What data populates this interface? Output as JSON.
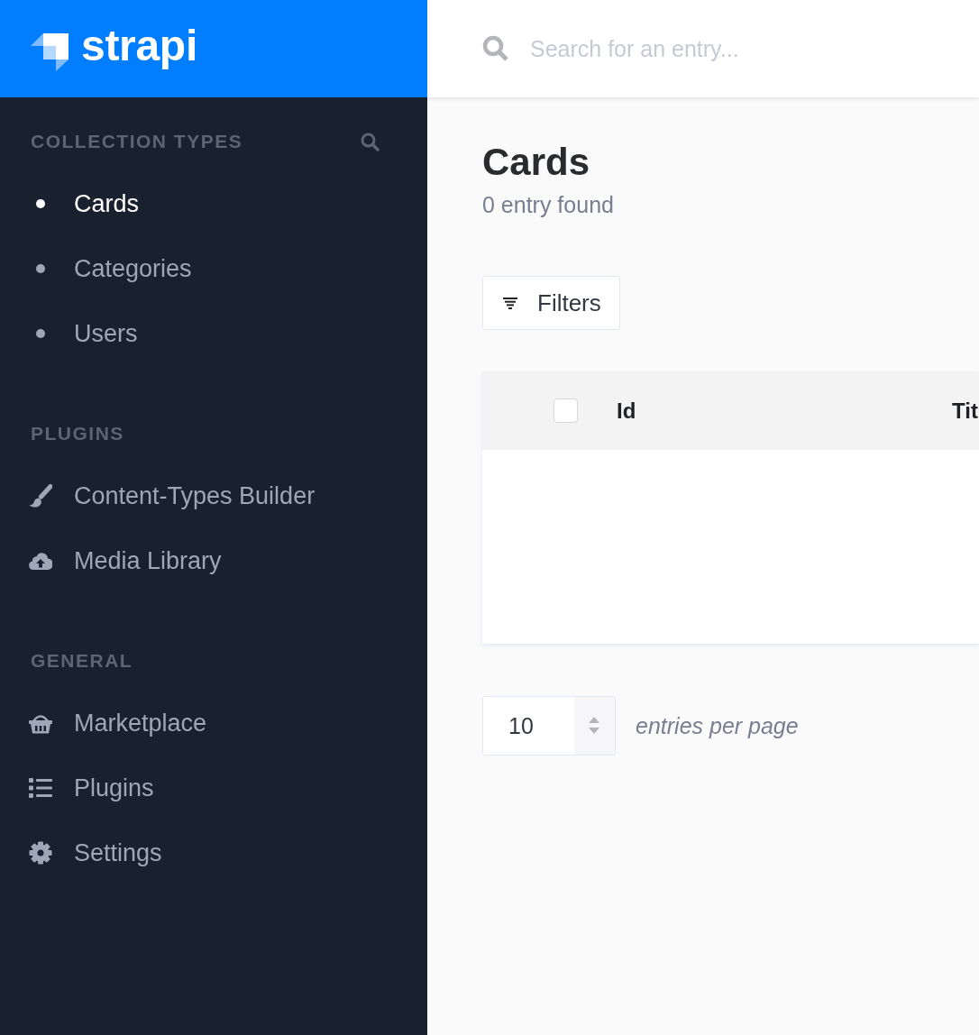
{
  "brand": {
    "name": "strapi"
  },
  "sidebar": {
    "sections": [
      {
        "title": "COLLECTION TYPES",
        "searchable": true,
        "items": [
          {
            "label": "Cards",
            "kind": "bullet",
            "selected": true
          },
          {
            "label": "Categories",
            "kind": "bullet",
            "selected": false
          },
          {
            "label": "Users",
            "kind": "bullet",
            "selected": false
          }
        ]
      },
      {
        "title": "PLUGINS",
        "searchable": false,
        "items": [
          {
            "label": "Content-Types Builder",
            "kind": "brush",
            "selected": false
          },
          {
            "label": "Media Library",
            "kind": "cloud",
            "selected": false
          }
        ]
      },
      {
        "title": "GENERAL",
        "searchable": false,
        "items": [
          {
            "label": "Marketplace",
            "kind": "basket",
            "selected": false
          },
          {
            "label": "Plugins",
            "kind": "list",
            "selected": false
          },
          {
            "label": "Settings",
            "kind": "gear",
            "selected": false
          }
        ]
      }
    ]
  },
  "topbar": {
    "search": {
      "placeholder": "Search for an entry..."
    }
  },
  "page": {
    "title": "Cards",
    "subtitle": "0 entry found",
    "filters_button": "Filters",
    "table": {
      "select_all": {
        "checked": false
      },
      "columns": [
        {
          "label": "Id"
        },
        {
          "label": "Tit"
        }
      ]
    },
    "pagination": {
      "value": "10",
      "label": "entries per page"
    }
  }
}
